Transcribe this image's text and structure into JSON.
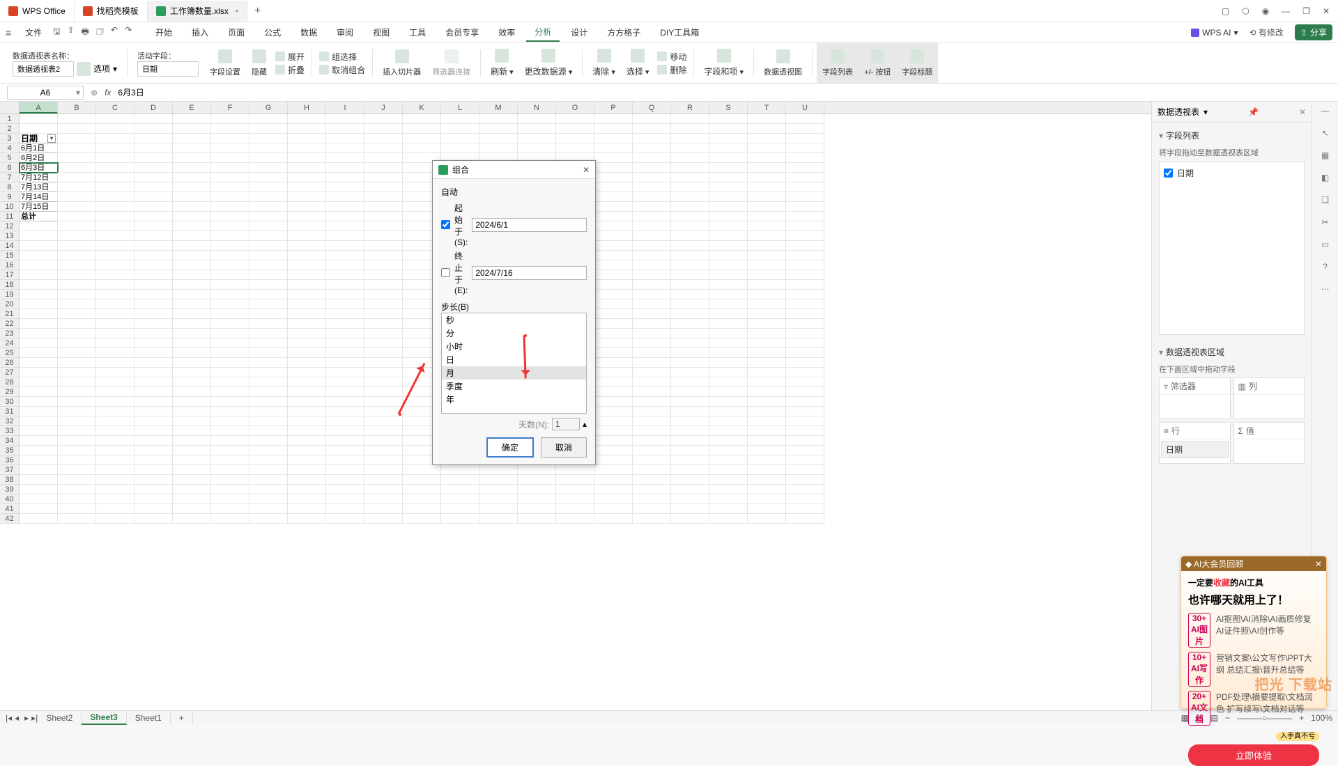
{
  "titlebar": {
    "tabs": [
      {
        "label": "WPS Office",
        "icon": "wps"
      },
      {
        "label": "找稻壳模板",
        "icon": "doc"
      },
      {
        "label": "工作簿数量.xlsx",
        "icon": "sht",
        "modified": "•"
      }
    ]
  },
  "menubar": {
    "file": "文件",
    "items": [
      "开始",
      "插入",
      "页面",
      "公式",
      "数据",
      "审阅",
      "视图",
      "工具",
      "会员专享",
      "效率",
      "分析",
      "设计",
      "方方格子",
      "DIY工具箱"
    ],
    "active": "分析",
    "wpsai": "WPS AI",
    "has_change": "有修改",
    "share": "分享"
  },
  "ribbon": {
    "pt_name_label": "数据透视表名称：",
    "pt_name_value": "数据透视表2",
    "options_label": "选项",
    "active_field_label": "活动字段：",
    "active_field_value": "日期",
    "field_set": "字段设置",
    "hide": "隐藏",
    "expand": "展开",
    "collapse": "折叠",
    "group_sel": "组选择",
    "ungroup": "取消组合",
    "insert_slicer": "插入切片器",
    "filter_conn": "筛选器连接",
    "refresh": "刷新",
    "change_src": "更改数据源",
    "clear": "清除",
    "select": "选择",
    "move": "移动",
    "delete": "删除",
    "field_item": "字段和项",
    "pivot_chart": "数据透视图",
    "field_list": "字段列表",
    "plusminus": "+/- 按钮",
    "field_title": "字段标题"
  },
  "formulabar": {
    "namebox": "A6",
    "value": "6月3日"
  },
  "columns": [
    "A",
    "B",
    "C",
    "D",
    "E",
    "F",
    "G",
    "H",
    "I",
    "J",
    "K",
    "L",
    "M",
    "N",
    "O",
    "P",
    "Q",
    "R",
    "S",
    "T",
    "U"
  ],
  "rows": [
    1,
    2,
    3,
    4,
    5,
    6,
    7,
    8,
    9,
    10,
    11,
    12,
    13,
    14,
    15,
    16,
    17,
    18,
    19,
    20,
    21,
    22,
    23,
    24,
    25,
    26,
    27,
    28,
    29,
    30,
    31,
    32,
    33,
    34,
    35,
    36,
    37,
    38,
    39,
    40,
    41,
    42
  ],
  "cells": {
    "A3": "日期",
    "A4": "6月1日",
    "A5": "6月2日",
    "A6": "6月3日",
    "A7": "7月12日",
    "A8": "7月13日",
    "A9": "7月14日",
    "A10": "7月15日",
    "A11": "总计"
  },
  "panel": {
    "title": "数据透视表",
    "section1": "字段列表",
    "hint1": "将字段拖动至数据透视表区域",
    "field1": "日期",
    "section2": "数据透视表区域",
    "hint2": "在下面区域中拖动字段",
    "areas": {
      "filter": "筛选器",
      "col": "列",
      "row": "行",
      "val": "值"
    },
    "row_item": "日期"
  },
  "dialog": {
    "title": "组合",
    "auto": "自动",
    "start_label": "起始于(S):",
    "start_val": "2024/6/1",
    "end_label": "终止于(E):",
    "end_val": "2024/7/16",
    "step_label": "步长(B)",
    "steps": [
      "秒",
      "分",
      "小时",
      "日",
      "月",
      "季度",
      "年"
    ],
    "sel_step": "月",
    "days_label": "天数(N):",
    "days_val": "1",
    "ok": "确定",
    "cancel": "取消"
  },
  "sheets": {
    "s1": "Sheet2",
    "s2": "Sheet3",
    "s3": "Sheet1",
    "active": "Sheet3"
  },
  "status": {
    "zoom": "100%"
  },
  "promo": {
    "bar": "AI大会员回顾",
    "l1a": "一定要",
    "l1b": "收藏",
    "l1c": "的AI工具",
    "l2": "也许哪天就用上了！",
    "items": [
      {
        "n": "30+",
        "t": "AI图片",
        "d": "AI抠图\\AI消除\\AI画质修复 AI证件照\\AI创作等"
      },
      {
        "n": "10+",
        "t": "AI写作",
        "d": "营销文案\\公文写作\\PPT大纲 总结汇报\\晋升总结等"
      },
      {
        "n": "20+",
        "t": "AI文档",
        "d": "PDF处理\\摘要提取\\文档润色 扩写续写\\文档对话等"
      }
    ],
    "badge": "入手真不亏",
    "btn": "立即体验"
  },
  "watermark": "把光 下载站"
}
